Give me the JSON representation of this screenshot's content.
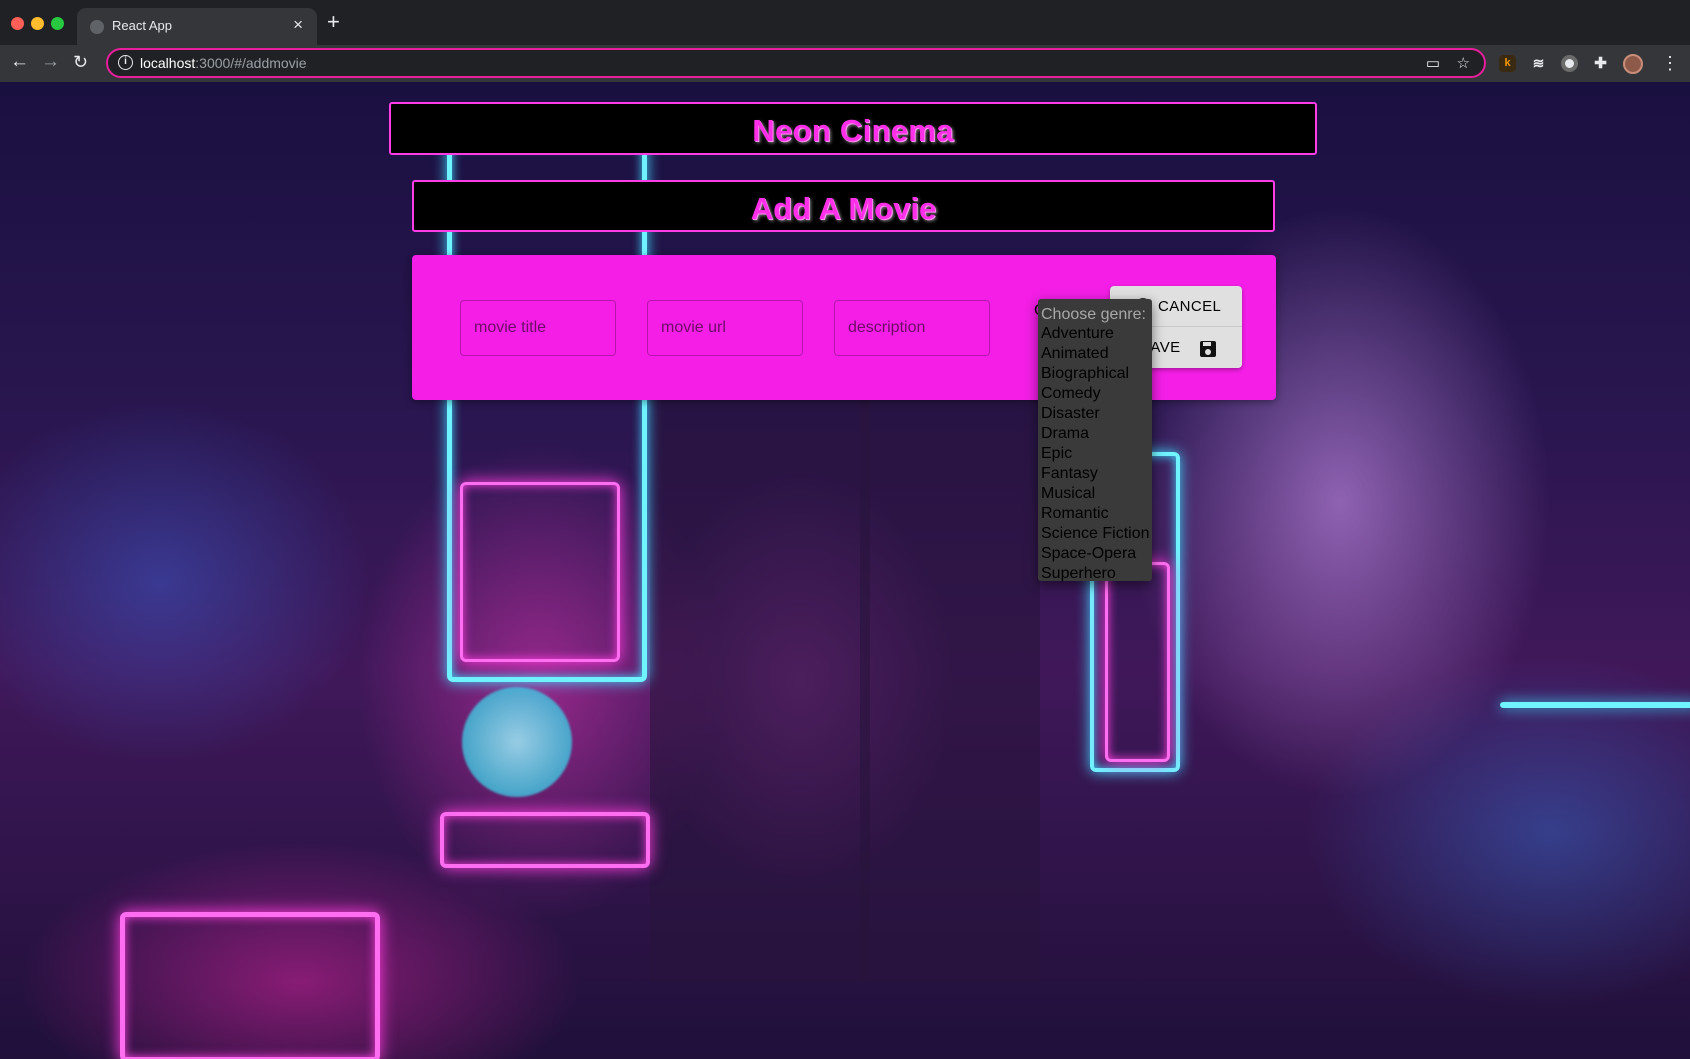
{
  "browser": {
    "tab_title": "React App",
    "tab_close": "×",
    "new_tab": "+",
    "url_host": "localhost",
    "url_rest": ":3000/#/addmovie",
    "info_glyph": "i",
    "back_glyph": "←",
    "forward_glyph": "→",
    "reload_glyph": "↻",
    "cast_glyph": "▭",
    "star_glyph": "☆",
    "ext_k_glyph": "k",
    "ext_stack_glyph": "≋",
    "ext_puzzle_glyph": "✚",
    "menu_glyph": "⋮",
    "accent_color": "#e91e9c"
  },
  "app": {
    "header_title": "Neon Cinema",
    "subheader_title": "Add A Movie",
    "brand_color": "#ff2ee8"
  },
  "form": {
    "title_placeholder": "movie title",
    "url_placeholder": "movie url",
    "description_placeholder": "description",
    "genre_partial_label": "C",
    "cancel_label": "CANCEL",
    "save_label": "SAVE",
    "background_color": "#f41ee6"
  },
  "genre_dropdown": {
    "header": "Choose genre:",
    "options": [
      "Adventure",
      "Animated",
      "Biographical",
      "Comedy",
      "Disaster",
      "Drama",
      "Epic",
      "Fantasy",
      "Musical",
      "Romantic",
      "Science Fiction",
      "Space-Opera",
      "Superhero"
    ]
  }
}
